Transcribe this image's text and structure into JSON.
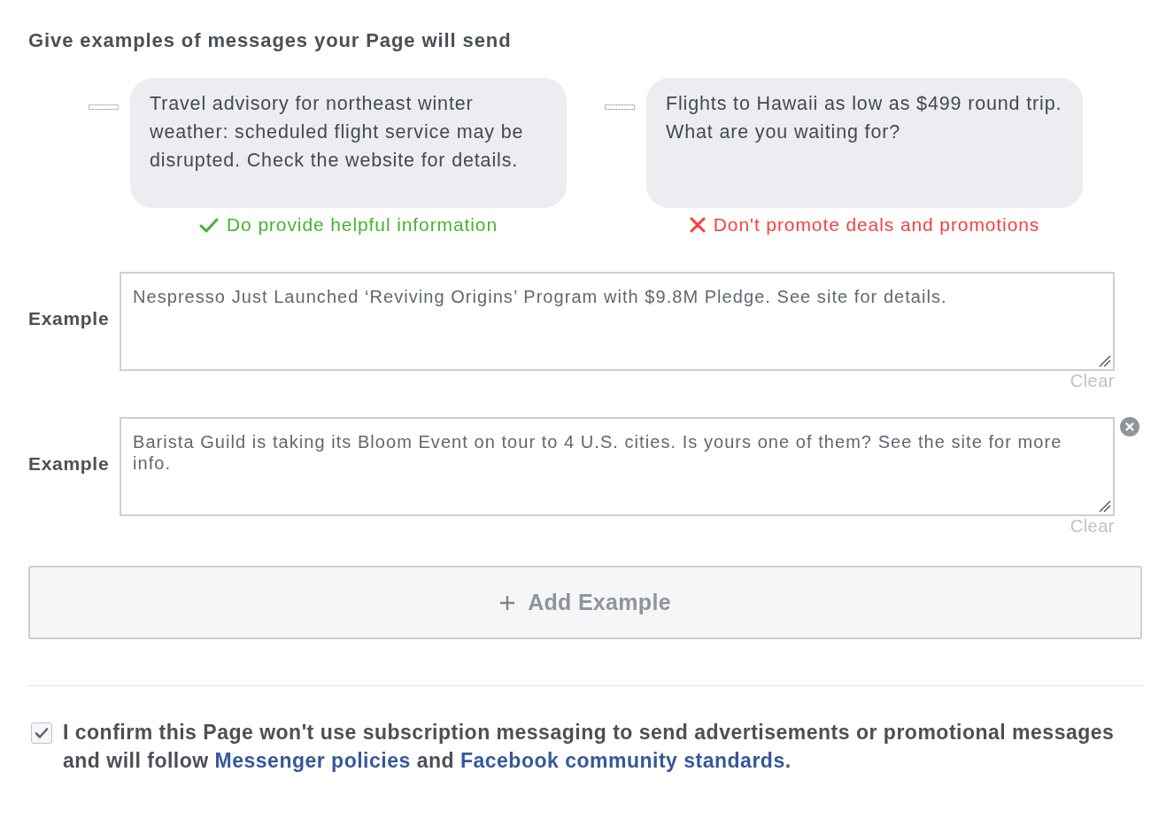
{
  "heading": "Give examples of messages your Page will send",
  "guidelines": [
    {
      "kind": "do",
      "message": "Travel advisory for northeast winter weather: scheduled flight service may be disrupted. Check the website for details.",
      "verdict": "Do provide helpful information"
    },
    {
      "kind": "dont",
      "message": "Flights to Hawaii as low as $499 round trip. What are you waiting for?",
      "verdict": "Don't promote deals and promotions"
    }
  ],
  "examples": [
    {
      "label": "Example",
      "value": "Nespresso Just Launched ‘Reviving Origins’ Program with $9.8M Pledge. See site for details.",
      "clear_label": "Clear",
      "removable": false
    },
    {
      "label": "Example",
      "value": "Barista Guild is taking its Bloom Event on tour to 4 U.S. cities. Is yours one of them? See the site for more info.",
      "clear_label": "Clear",
      "removable": true
    }
  ],
  "add_button": {
    "label": "Add Example"
  },
  "confirm": {
    "checked": true,
    "parts": [
      {
        "kind": "text",
        "text": "I confirm this Page won't use subscription messaging to send advertisements or promotional messages and will follow "
      },
      {
        "kind": "link",
        "text": "Messenger policies"
      },
      {
        "kind": "text",
        "text": " and "
      },
      {
        "kind": "link",
        "text": "Facebook community standards."
      }
    ]
  }
}
